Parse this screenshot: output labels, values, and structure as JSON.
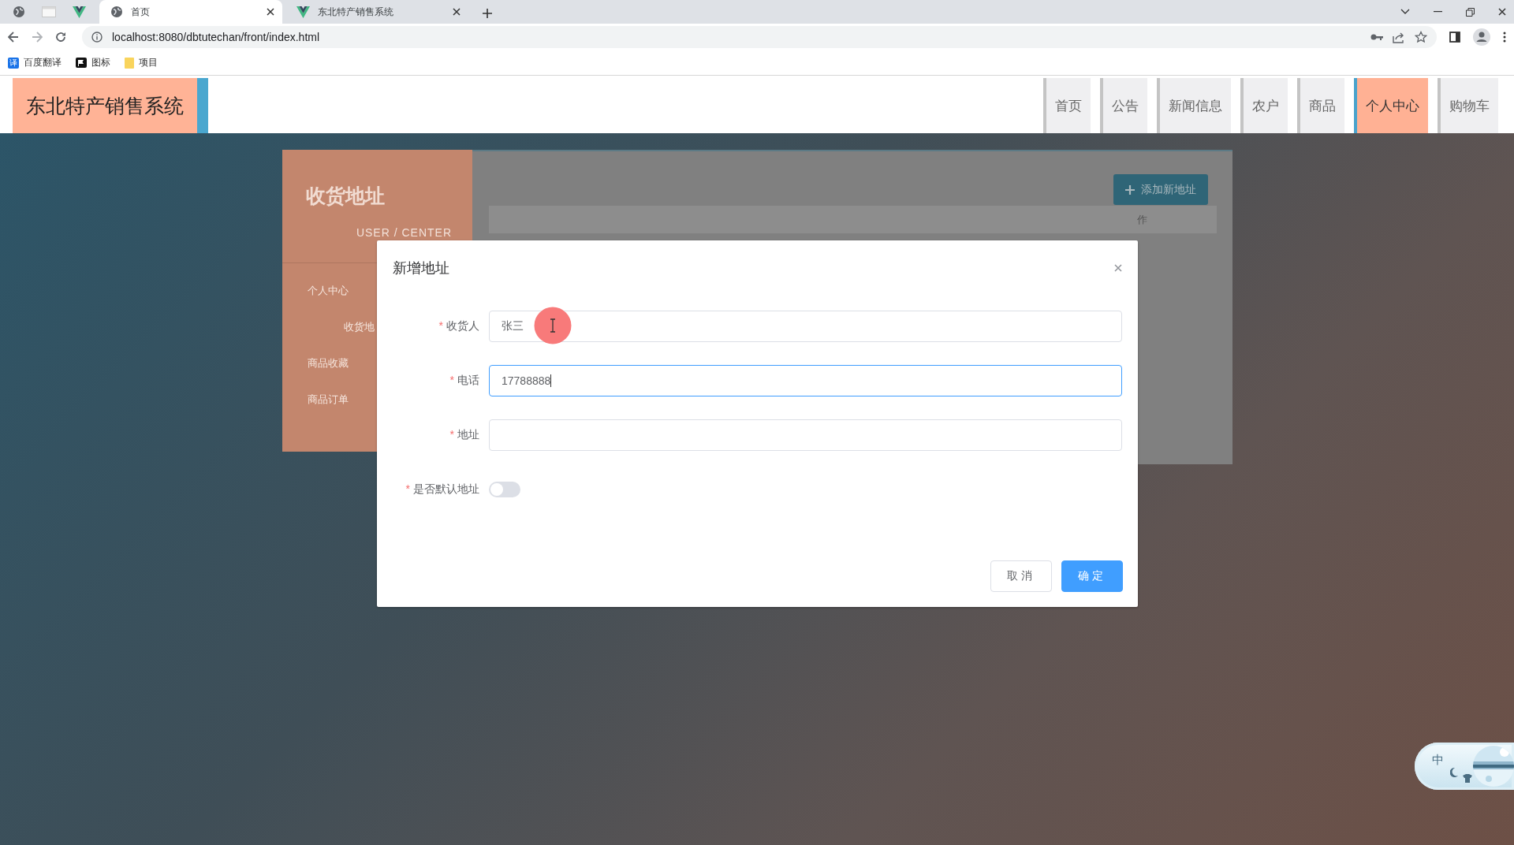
{
  "browser": {
    "tabs": [
      {
        "kind": "pinned",
        "selected": false
      },
      {
        "kind": "pinned",
        "selected": false
      },
      {
        "kind": "pinned",
        "selected": false
      },
      {
        "kind": "full",
        "title": "首页",
        "selected": true
      },
      {
        "kind": "full",
        "title": "东北特产销售系统",
        "selected": false
      }
    ],
    "address": "localhost:8080/dbtutechan/front/index.html",
    "bookmarks": [
      {
        "label": "百度翻译",
        "icon_text": "译"
      },
      {
        "label": "图标"
      },
      {
        "label": "项目"
      }
    ]
  },
  "site": {
    "logo": "东北特产销售系统",
    "nav": [
      {
        "label": "首页",
        "selected": false
      },
      {
        "label": "公告",
        "selected": false
      },
      {
        "label": "新闻信息",
        "selected": false
      },
      {
        "label": "农户",
        "selected": false
      },
      {
        "label": "商品",
        "selected": false
      },
      {
        "label": "个人中心",
        "selected": true
      },
      {
        "label": "购物车",
        "selected": false
      }
    ]
  },
  "sidebar": {
    "title": "收货地址",
    "subtitle": "USER / CENTER",
    "items": [
      {
        "label": "个人中心",
        "children": [
          {
            "label": "收货地"
          }
        ]
      },
      {
        "label": "商品收藏"
      },
      {
        "label": "商品订单"
      }
    ]
  },
  "main": {
    "add_button": "添加新地址",
    "table": {
      "columns": [
        "作"
      ]
    }
  },
  "dialog": {
    "title": "新增地址",
    "required_mark": "*",
    "fields": [
      {
        "label": "收货人",
        "required": true,
        "value": "张三",
        "focused": false
      },
      {
        "label": "电话",
        "required": true,
        "value": "17788888",
        "focused": true
      },
      {
        "label": "地址",
        "required": true,
        "focused": false
      }
    ],
    "toggle": {
      "label": "是否默认地址",
      "required": true,
      "on": false
    },
    "buttons": [
      {
        "label": "取消",
        "kind": "default"
      },
      {
        "label": "确定",
        "kind": "primary"
      }
    ]
  },
  "ime": {
    "mode": "中"
  }
}
